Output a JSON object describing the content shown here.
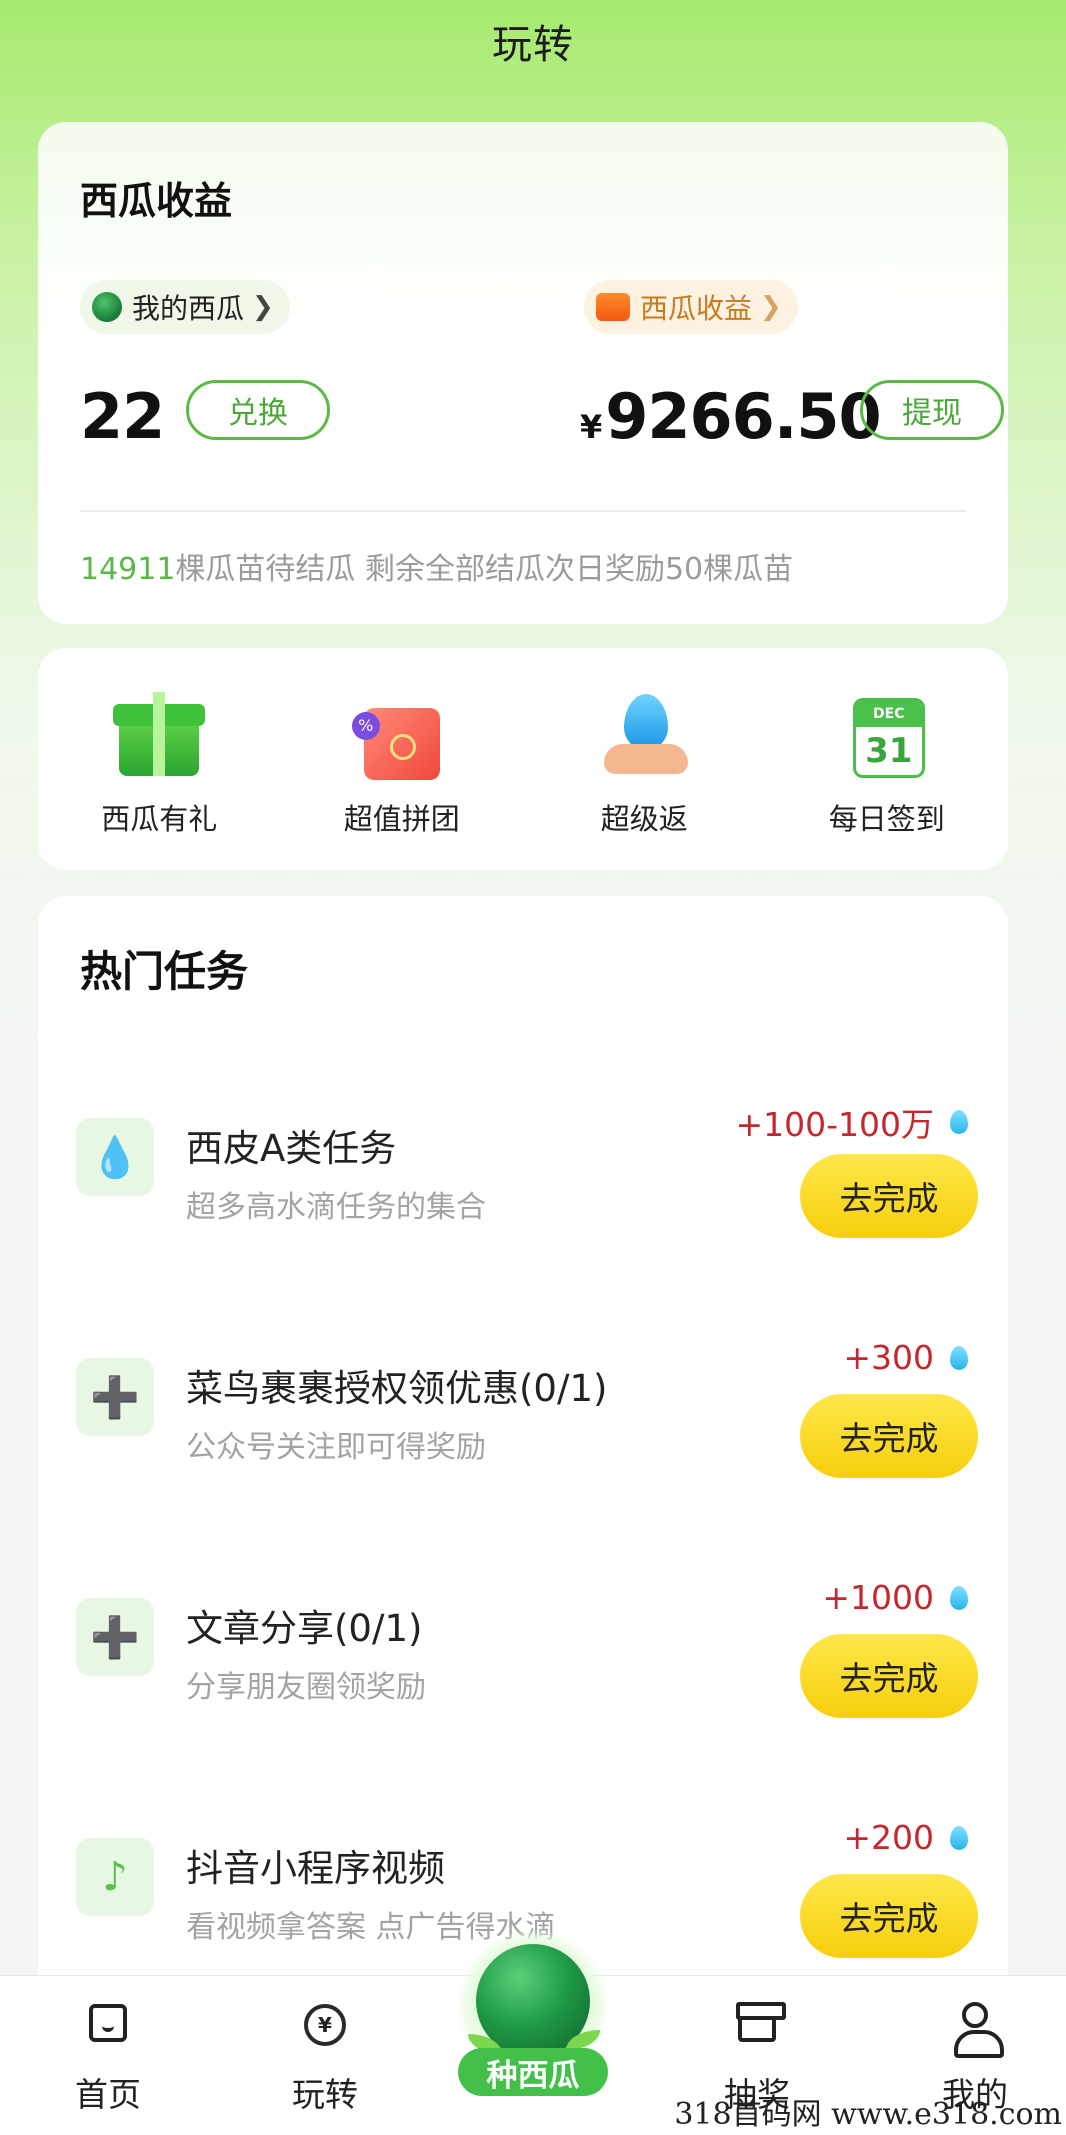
{
  "header": {
    "title": "玩转"
  },
  "earnings": {
    "title": "西瓜收益",
    "my_melon_label": "我的西瓜",
    "melon_income_label": "西瓜收益",
    "melon_count": "22",
    "exchange_label": "兑换",
    "currency_symbol": "¥",
    "income_amount": "9266.50",
    "withdraw_label": "提现",
    "sprout_count": "14911",
    "sprout_text": "棵瓜苗待结瓜 剩余全部结瓜次日奖励50棵瓜苗"
  },
  "features": [
    {
      "label": "西瓜有礼",
      "icon": "gift-box-icon"
    },
    {
      "label": "超值拼团",
      "icon": "shopping-bag-icon"
    },
    {
      "label": "超级返",
      "icon": "water-drop-hand-icon"
    },
    {
      "label": "每日签到",
      "icon": "calendar-icon",
      "cal_month": "DEC",
      "cal_day": "31"
    }
  ],
  "tasks": {
    "title": "热门任务",
    "items": [
      {
        "name": "西皮A类任务",
        "desc": "超多高水滴任务的集合",
        "reward": "+100-100万",
        "button": "去完成",
        "icon": "water-drop-icon"
      },
      {
        "name": "菜鸟裹裹授权领优惠(0/1)",
        "desc": "公众号关注即可得奖励",
        "reward": "+300",
        "button": "去完成",
        "icon": "add-user-icon"
      },
      {
        "name": "文章分享(0/1)",
        "desc": "分享朋友圈领奖励",
        "reward": "+1000",
        "button": "去完成",
        "icon": "add-user-icon"
      },
      {
        "name": "抖音小程序视频",
        "desc": "看视频拿答案 点广告得水滴",
        "reward": "+200",
        "button": "去完成",
        "icon": "tiktok-icon"
      }
    ]
  },
  "tabbar": {
    "home": "首页",
    "play": "玩转",
    "plant": "种西瓜",
    "lottery": "抽奖",
    "mine": "我的"
  },
  "watermark": "318首码网 www.e318.com",
  "colors": {
    "accent_green": "#5aba45",
    "reward_red": "#c4272e",
    "button_yellow": "#f6cf0c"
  }
}
